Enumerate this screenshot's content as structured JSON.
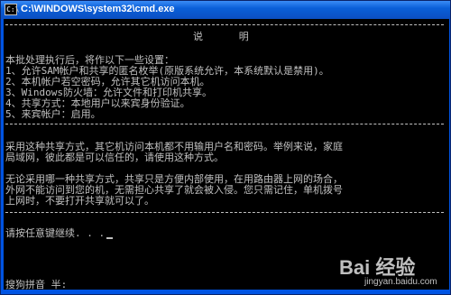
{
  "window": {
    "title": "C:\\WINDOWS\\system32\\cmd.exe",
    "icon_text": "C:\\"
  },
  "console": {
    "heading": "说      明",
    "lines": [
      "本批处理执行后，将作以下一些设置：",
      "1、允许SAM帐户和共享的匿名枚举(原版系统允许，本系统默认是禁用)。",
      "2、本机帐户若空密码，允许其它机访问本机。",
      "3、Windows防火墙：允许文件和打印机共享。",
      "4、共享方式：本地用户以来宾身份验证。",
      "5、来宾帐户：启用。"
    ],
    "paragraph1": [
      "采用这种共享方式，其它机访问本机都不用输用户名和密码。举例来说，家庭",
      "局域网，彼此都是可以信任的，请使用这种方式。"
    ],
    "paragraph2": [
      "无论采用哪一种共享方式，共享只是方便内部使用，在用路由器上网的场合，",
      "外网不能访问到您的机，无需担心共享了就会被入侵。您只需记住，单机拨号",
      "上网时，不要打开共享就可以了。"
    ],
    "prompt": "请按任意键继续. . ."
  },
  "ime": {
    "status": "搜狗拼音 半:"
  },
  "watermark": {
    "logo": "Bai 经验",
    "url": "jingyan.baidu.com"
  }
}
